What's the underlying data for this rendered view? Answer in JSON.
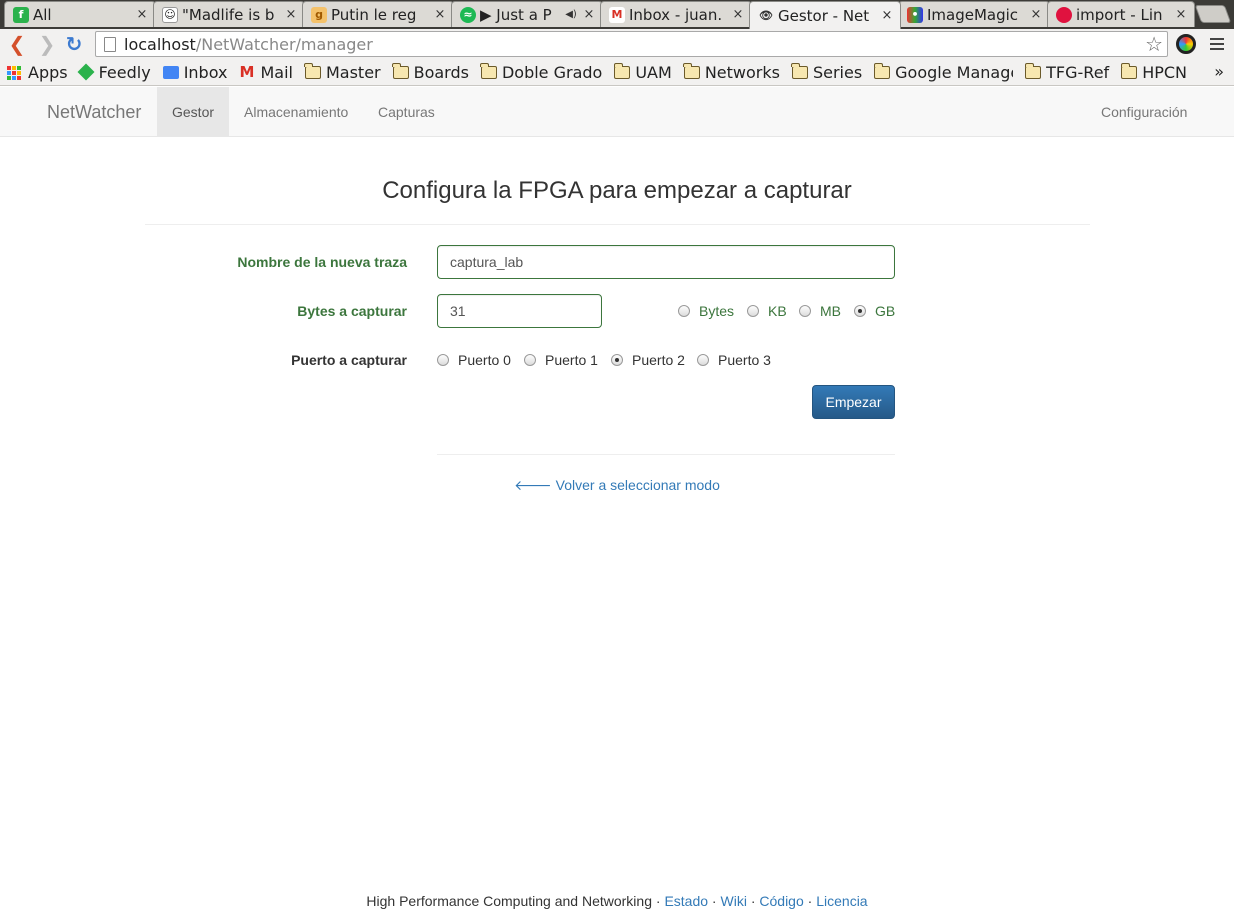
{
  "browser": {
    "tabs": [
      {
        "title": "All",
        "favicon": "feedly-icon",
        "color": "#2bb24c"
      },
      {
        "title": "\"Madlife is b",
        "favicon": "reddit-icon",
        "color": "#ff4500"
      },
      {
        "title": "Putin le reg",
        "favicon": "page-icon",
        "color": "#e8a33d"
      },
      {
        "title": "▶ Just a P",
        "favicon": "spotify-icon",
        "color": "#1db954"
      },
      {
        "title": "Inbox - juan.",
        "favicon": "gmail-icon",
        "color": "#d93025"
      },
      {
        "title": "Gestor - Net",
        "favicon": "eye-icon",
        "color": "#333333"
      },
      {
        "title": "ImageMagic",
        "favicon": "imagemagick-icon",
        "color": "#7b3fa0"
      },
      {
        "title": "import - Lin",
        "favicon": "ubuntu-icon",
        "color": "#e0123f"
      }
    ],
    "tab_close": "×",
    "url_host": "localhost",
    "url_path": "/NetWatcher/manager",
    "back": "❮",
    "forward": "❯",
    "reload": "↻",
    "star": "☆",
    "bookmarks": [
      {
        "label": "Apps",
        "type": "apps"
      },
      {
        "label": "Feedly",
        "type": "feedly"
      },
      {
        "label": "Inbox",
        "type": "inbox"
      },
      {
        "label": "Mail",
        "type": "gmail"
      },
      {
        "label": "Master",
        "type": "folder"
      },
      {
        "label": "Boards",
        "type": "folder"
      },
      {
        "label": "Doble Grado",
        "type": "folder"
      },
      {
        "label": "UAM",
        "type": "folder"
      },
      {
        "label": "Networks",
        "type": "folder"
      },
      {
        "label": "Series",
        "type": "folder"
      },
      {
        "label": "Google Manage",
        "type": "folder"
      },
      {
        "label": "TFG-Ref",
        "type": "folder"
      },
      {
        "label": "HPCN",
        "type": "folder"
      }
    ],
    "bookmarks_more": "»"
  },
  "nav": {
    "brand": "NetWatcher",
    "links": [
      "Gestor",
      "Almacenamiento",
      "Capturas"
    ],
    "active": "Gestor",
    "right_link": "Configuración"
  },
  "form": {
    "heading": "Configura la FPGA para empezar a capturar",
    "name_label": "Nombre de la nueva traza",
    "name_value": "captura_lab",
    "bytes_label": "Bytes a capturar",
    "bytes_value": "31",
    "unit_options": [
      "Bytes",
      "KB",
      "MB",
      "GB"
    ],
    "unit_selected": "GB",
    "port_label": "Puerto a capturar",
    "port_options": [
      "Puerto 0",
      "Puerto 1",
      "Puerto 2",
      "Puerto 3"
    ],
    "port_selected": "Puerto 2",
    "start_button": "Empezar",
    "back_link": "Volver a seleccionar modo"
  },
  "footer": {
    "text": "High Performance Computing and Networking",
    "separator": " · ",
    "links": [
      "Estado",
      "Wiki",
      "Código",
      "Licencia"
    ]
  },
  "colors": {
    "success": "#3c763d",
    "primary": "#337ab7",
    "link": "#337ab7"
  }
}
